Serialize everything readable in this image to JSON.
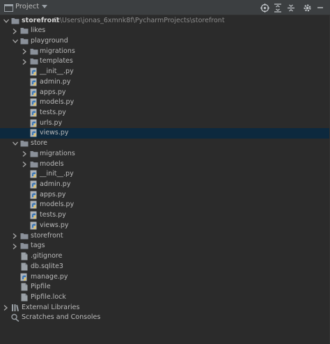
{
  "header": {
    "title": "Project",
    "icons": [
      "project-view-icon",
      "dropdown-icon",
      "locate-icon",
      "expand-all-icon",
      "collapse-all-icon",
      "gear-icon"
    ]
  },
  "tree": {
    "root": {
      "label": "storefront",
      "path": "C:\\Users\\jonas_6xmnk8f\\PycharmProjects\\storefront"
    },
    "items": [
      {
        "label": "likes",
        "kind": "folder",
        "level": 1,
        "expanded": false
      },
      {
        "label": "playground",
        "kind": "folder",
        "level": 1,
        "expanded": true
      },
      {
        "label": "migrations",
        "kind": "folder",
        "level": 2,
        "expanded": false
      },
      {
        "label": "templates",
        "kind": "folder",
        "level": 2,
        "expanded": false
      },
      {
        "label": "__init__.py",
        "kind": "py",
        "level": 3
      },
      {
        "label": "admin.py",
        "kind": "py",
        "level": 3
      },
      {
        "label": "apps.py",
        "kind": "py",
        "level": 3
      },
      {
        "label": "models.py",
        "kind": "py",
        "level": 3
      },
      {
        "label": "tests.py",
        "kind": "py",
        "level": 3
      },
      {
        "label": "urls.py",
        "kind": "py",
        "level": 3
      },
      {
        "label": "views.py",
        "kind": "py",
        "level": 3,
        "selected": true
      },
      {
        "label": "store",
        "kind": "folder",
        "level": 1,
        "expanded": true
      },
      {
        "label": "migrations",
        "kind": "folder",
        "level": 2,
        "expanded": false
      },
      {
        "label": "models",
        "kind": "folder",
        "level": 2,
        "expanded": false
      },
      {
        "label": "__init__.py",
        "kind": "py",
        "level": 3
      },
      {
        "label": "admin.py",
        "kind": "py",
        "level": 3
      },
      {
        "label": "apps.py",
        "kind": "py",
        "level": 3
      },
      {
        "label": "models.py",
        "kind": "py",
        "level": 3
      },
      {
        "label": "tests.py",
        "kind": "py",
        "level": 3
      },
      {
        "label": "views.py",
        "kind": "py",
        "level": 3
      },
      {
        "label": "storefront",
        "kind": "folder",
        "level": 1,
        "expanded": false
      },
      {
        "label": "tags",
        "kind": "folder",
        "level": 1,
        "expanded": false
      },
      {
        "label": ".gitignore",
        "kind": "file",
        "level": 2
      },
      {
        "label": "db.sqlite3",
        "kind": "file",
        "level": 2
      },
      {
        "label": "manage.py",
        "kind": "py",
        "level": 2
      },
      {
        "label": "Pipfile",
        "kind": "file",
        "level": 2
      },
      {
        "label": "Pipfile.lock",
        "kind": "file",
        "level": 2
      }
    ],
    "external": "External Libraries",
    "scratches": "Scratches and Consoles"
  },
  "colors": {
    "background": "#2b2b2b",
    "header": "#3c3f41",
    "selection": "#0d293e",
    "folder": "#8a9099",
    "python_blue": "#3c78b4",
    "python_yellow": "#f2c94c"
  }
}
